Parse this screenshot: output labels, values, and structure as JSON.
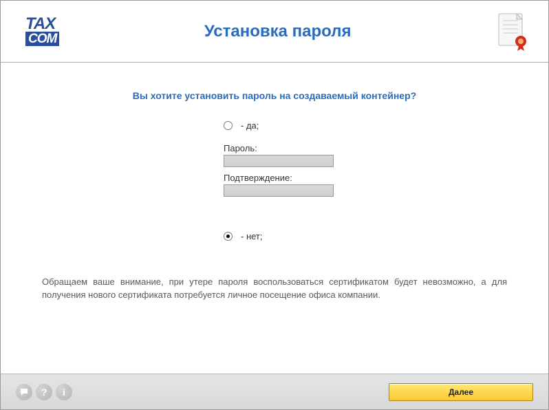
{
  "logo": {
    "top": "TAX",
    "bottom": "COM"
  },
  "title": "Установка пароля",
  "question": "Вы хотите установить пароль на создаваемый контейнер?",
  "options": {
    "yes": "- да;",
    "no": "- нет;",
    "selected": "no"
  },
  "fields": {
    "password_label": "Пароль:",
    "confirm_label": "Подтверждение:",
    "password_value": "",
    "confirm_value": ""
  },
  "warning": "Обращаем ваше внимание, при утере пароля воспользоваться сертификатом будет невозможно, а для получения нового сертификата потребуется личное посещение офиса компании.",
  "footer": {
    "next_label": "Далее"
  }
}
